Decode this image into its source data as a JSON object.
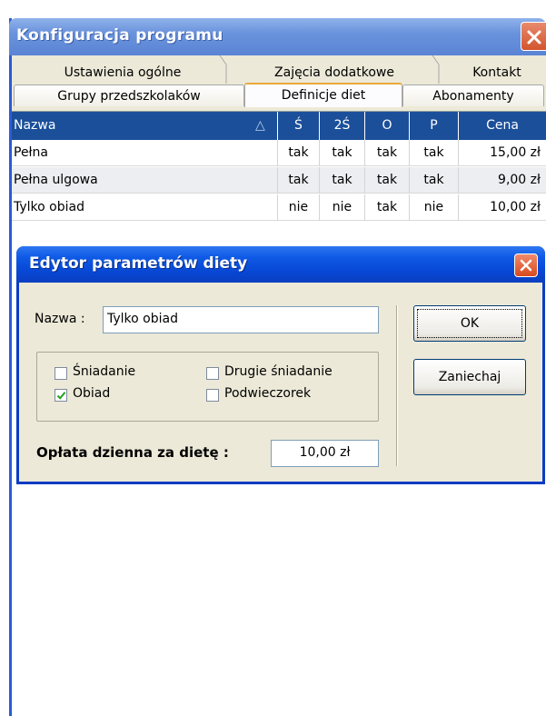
{
  "window": {
    "title": "Konfiguracja programu"
  },
  "tabs": {
    "row1": [
      "Ustawienia ogólne",
      "Zajęcia dodatkowe",
      "Kontakt"
    ],
    "row2": [
      "Grupy przedszkolaków",
      "Definicje diet",
      "Abonamenty"
    ],
    "active": "Definicje diet"
  },
  "grid": {
    "columns": [
      "Nazwa",
      "Ś",
      "2Ś",
      "O",
      "P",
      "Cena"
    ],
    "sort_indicator": "△",
    "rows": [
      [
        "Pełna",
        "tak",
        "tak",
        "tak",
        "tak",
        "15,00 zł"
      ],
      [
        "Pełna ulgowa",
        "tak",
        "tak",
        "tak",
        "tak",
        "9,00 zł"
      ],
      [
        "Tylko obiad",
        "nie",
        "nie",
        "tak",
        "nie",
        "10,00 zł"
      ]
    ]
  },
  "dialog": {
    "title": "Edytor parametrów diety",
    "name_label": "Nazwa :",
    "name_value": "Tylko obiad",
    "meals": [
      {
        "label": "Śniadanie",
        "checked": false
      },
      {
        "label": "Drugie śniadanie",
        "checked": false
      },
      {
        "label": "Obiad",
        "checked": true
      },
      {
        "label": "Podwieczorek",
        "checked": false
      }
    ],
    "fee_label": "Opłata dzienna za dietę :",
    "fee_value": "10,00 zł",
    "ok_label": "OK",
    "cancel_label": "Zaniechaj"
  },
  "colors": {
    "grid_header": "#1b4f9a",
    "dialog_title": "#0747d4",
    "window_title": "#6a93dd",
    "close_button": "#d94a1e"
  }
}
